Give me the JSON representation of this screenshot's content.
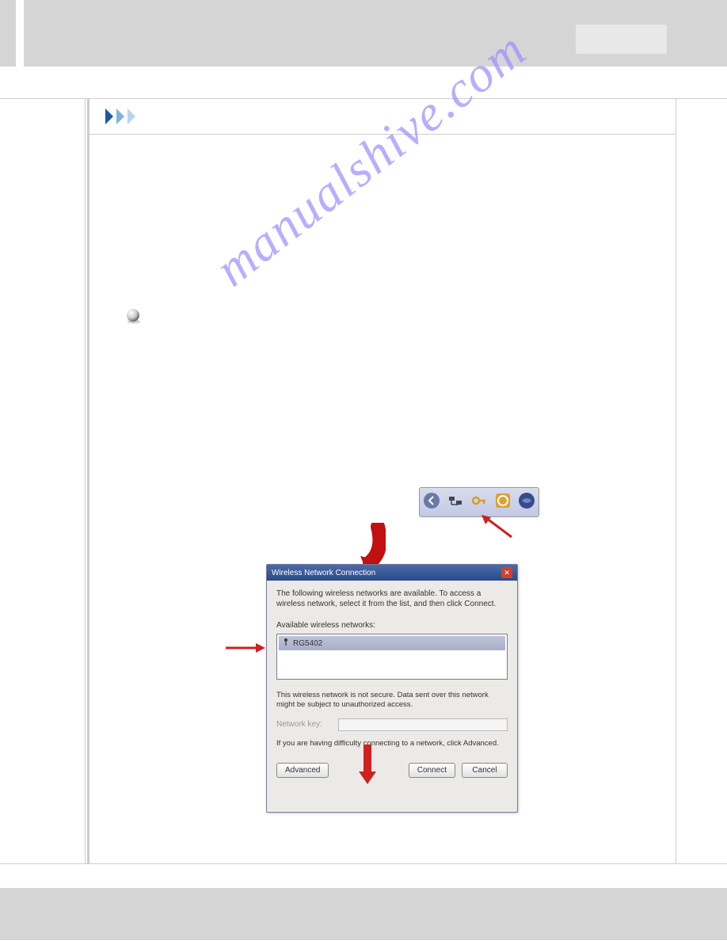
{
  "watermark": "manualshive.com",
  "dialog": {
    "title": "Wireless Network Connection",
    "intro": "The following wireless networks are available. To access a wireless network, select it from the list, and then click Connect.",
    "list_label": "Available wireless networks:",
    "item": "RG5402",
    "warning": "This wireless network is not secure. Data sent over this network might be subject to unauthorized access.",
    "key_label": "Network key:",
    "help": "If you are having difficulty connecting to a network, click Advanced.",
    "btn_advanced": "Advanced",
    "btn_connect": "Connect",
    "btn_cancel": "Cancel"
  }
}
